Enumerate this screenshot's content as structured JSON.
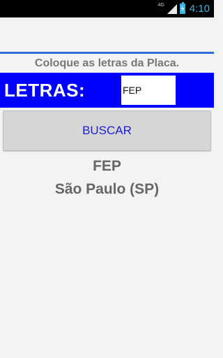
{
  "status_bar": {
    "network_label": "4G",
    "time": "4:10"
  },
  "main": {
    "instruction": "Coloque as letras da Placa.",
    "letters_label": "LETRAS:",
    "letters_value": "FEP",
    "search_button": "BUSCAR",
    "result_code": "FEP",
    "result_state": "São Paulo (SP)"
  },
  "colors": {
    "status_accent": "#33b5e5",
    "letters_bar": "#0000ff",
    "button_text": "#1d1dd6",
    "divider": "#2d6fd8"
  }
}
